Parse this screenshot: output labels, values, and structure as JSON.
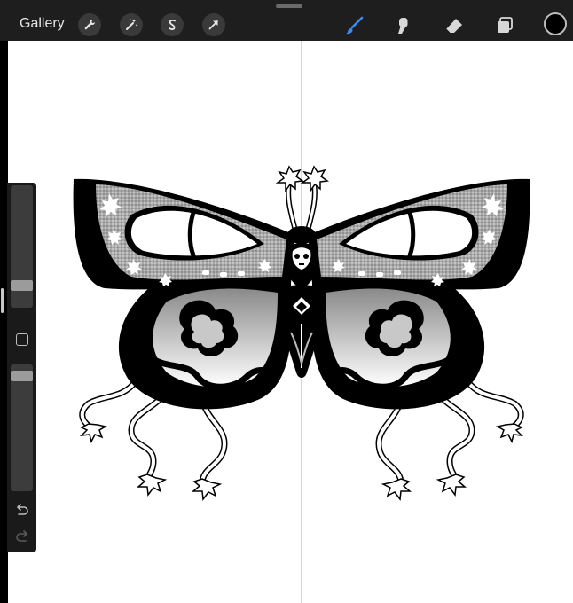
{
  "toolbar": {
    "gallery_label": "Gallery",
    "left_tools": [
      "wrench-icon",
      "magic-wand-icon",
      "selection-icon",
      "transform-arrow-icon"
    ],
    "right_tools": [
      "brush-icon",
      "smudge-icon",
      "eraser-icon",
      "layers-icon"
    ],
    "active_tool": "brush-icon",
    "accent_color": "#3d8bf2",
    "current_color": "#000000"
  },
  "sidebar": {
    "brush_size_level": 0.8,
    "opacity_level": 0.95,
    "icons": [
      "modify-square-icon",
      "undo-icon",
      "redo-icon"
    ]
  },
  "canvas": {
    "background": "#ffffff",
    "symmetry_guide": "vertical",
    "artwork": "butterfly-illustration"
  }
}
